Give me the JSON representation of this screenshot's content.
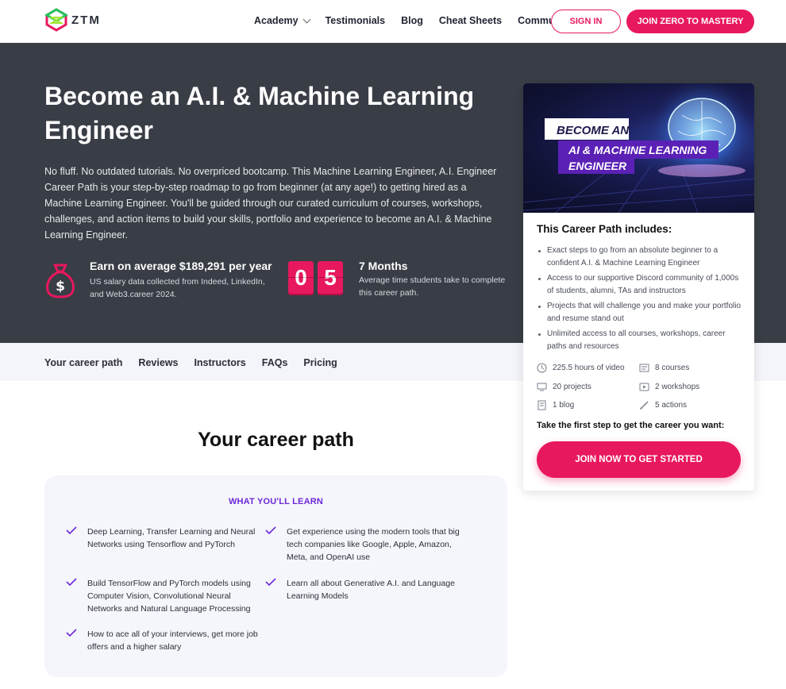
{
  "nav": {
    "logo_text": "ZTM",
    "links": [
      "Academy",
      "Testimonials",
      "Blog",
      "Cheat Sheets",
      "Community"
    ],
    "signin_label": "SIGN IN",
    "join_label": "JOIN ZERO TO MASTERY"
  },
  "hero": {
    "title": "Become an A.I. & Machine Learning Engineer",
    "description": "No fluff. No outdated tutorials. No overpriced bootcamp. This Machine Learning Engineer, A.I. Engineer Career Path is your step-by-step roadmap to go from beginner (at any age!) to getting hired as a Machine Learning Engineer. You'll be guided through our curated curriculum of courses, workshops, challenges, and action items to build your skills, portfolio and experience to become an A.I. & Machine Learning Engineer.",
    "earn_title": "Earn on average $189,291 per year",
    "earn_sub": "US salary data collected from Indeed, LinkedIn, and Web3.career 2024.",
    "digits": [
      "0",
      "5"
    ],
    "months_title": "7 Months",
    "months_sub": "Average time students take to complete this career path."
  },
  "subnav": {
    "items": [
      "Your career path",
      "Reviews",
      "Instructors",
      "FAQs",
      "Pricing"
    ]
  },
  "career": {
    "title": "Your career path",
    "learn_heading": "WHAT YOU'LL LEARN",
    "items": [
      "Deep Learning, Transfer Learning and Neural Networks using Tensorflow and PyTorch",
      "Get experience using the modern tools that big tech companies like Google, Apple, Amazon, Meta, and OpenAI use",
      "Build TensorFlow and PyTorch models using Computer Vision, Convolutional Neural Networks and Natural Language Processing",
      "Learn all about Generative A.I. and Language Learning Models",
      "How to ace all of your interviews, get more job offers and a higher salary"
    ]
  },
  "card": {
    "banner_line1": "BECOME AN",
    "banner_line2": "AI & MACHINE LEARNING",
    "banner_line3": "ENGINEER",
    "title": "This Career Path includes:",
    "includes": [
      "Exact steps to go from an absolute beginner to a confident A.I. & Machine Learning Engineer",
      "Access to our supportive Discord community of 1,000s of students, alumni, TAs and instructors",
      "Projects that will challenge you and make your portfolio and resume stand out",
      "Unlimited access to all courses, workshops, career paths and resources"
    ],
    "features": {
      "video": "225.5 hours of video",
      "courses": "8 courses",
      "projects": "20 projects",
      "workshops": "2 workshops",
      "blog": "1 blog",
      "actions": "5 actions"
    },
    "cta_text": "Take the first step to get the career you want:",
    "cta_button": "JOIN NOW TO GET STARTED"
  },
  "colors": {
    "accent": "#e8185f",
    "hero_bg": "#393d45",
    "purple": "#6d28d9"
  }
}
